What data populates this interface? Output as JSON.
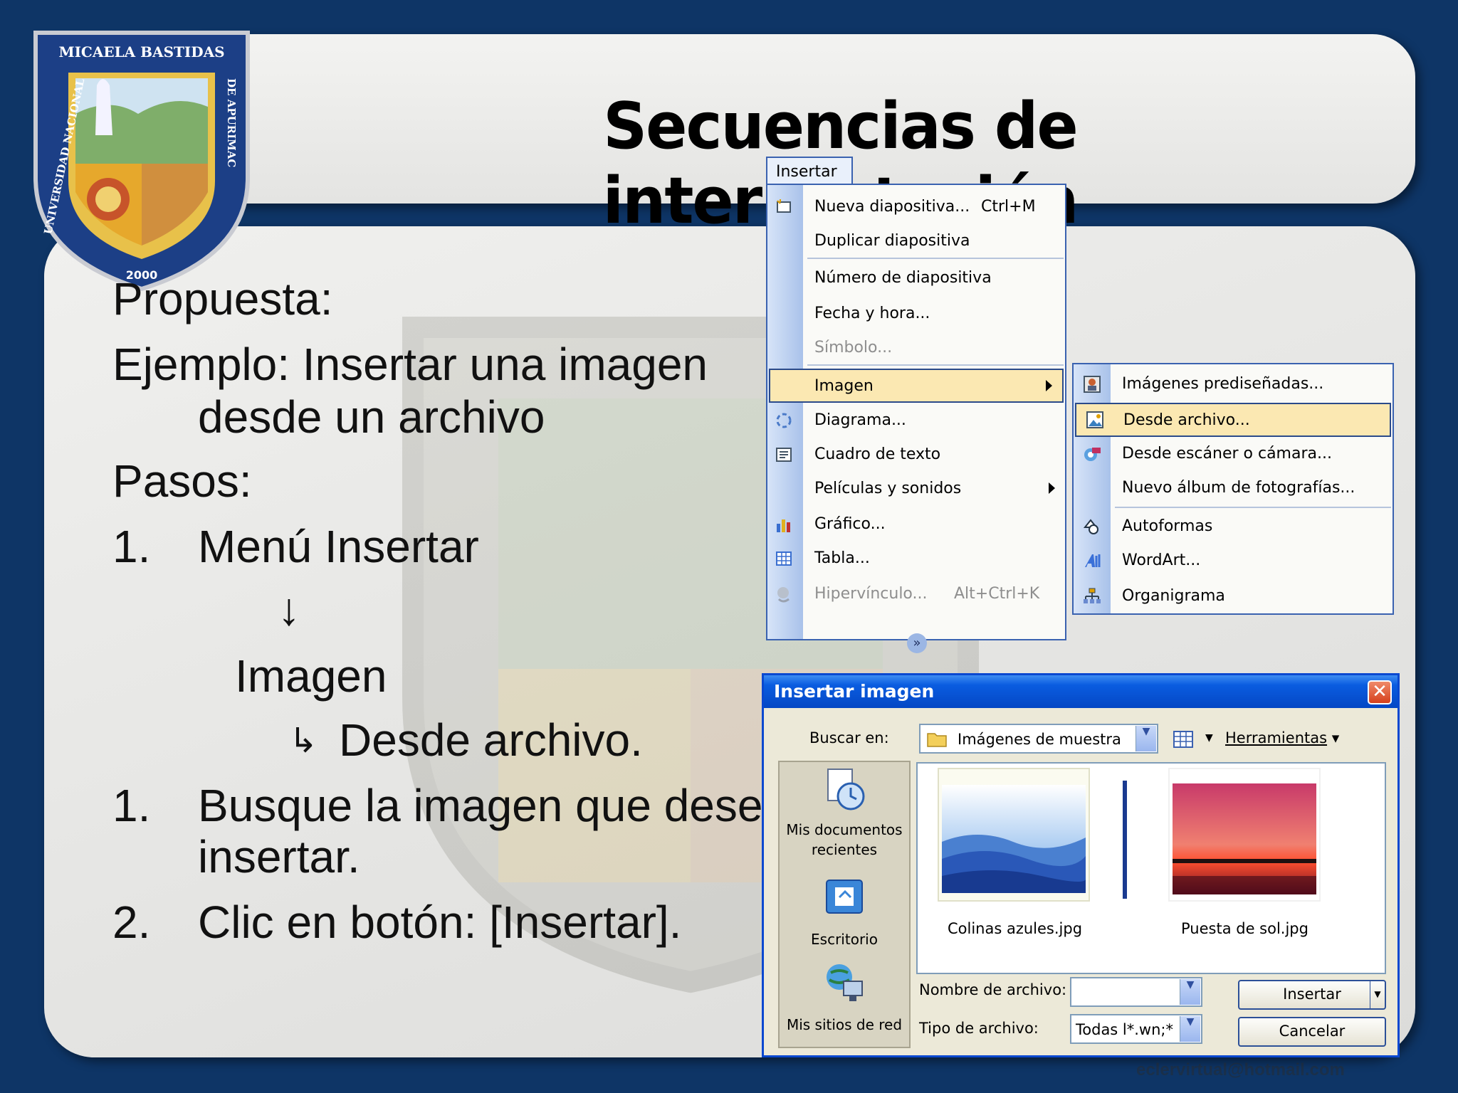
{
  "slide": {
    "title": "Secuencias de interpretación",
    "footer_email": "eclervirtual@hotmail.com"
  },
  "logo": {
    "top_text": "MICAELA BASTIDAS",
    "left_text": "UNIVERSIDAD NACIONAL",
    "right_text": "DE APURIMAC",
    "year": "2000"
  },
  "bullets": {
    "propuesta": "Propuesta:",
    "ejemplo_1": "Ejemplo: Insertar una imagen",
    "ejemplo_2": "desde un archivo",
    "pasos": "Pasos:",
    "step1_num": "1.",
    "step1_text": "Menú Insertar",
    "arrow_down": "↓",
    "imagen": "Imagen",
    "arrow_corner": "↳",
    "desde_archivo": "Desde archivo.",
    "step2_num": "1.",
    "step2_text_1": "Busque la imagen que desee",
    "step2_text_2": "insertar.",
    "step3_num": "2.",
    "step3_text": "Clic en botón:  [Insertar]."
  },
  "menu": {
    "tab_label": "Insertar",
    "items": [
      {
        "label": "Nueva diapositiva...",
        "shortcut": "Ctrl+M"
      },
      {
        "label": "Duplicar diapositiva"
      },
      {
        "label": "Número de diapositiva"
      },
      {
        "label": "Fecha y hora..."
      },
      {
        "label": "Símbolo..."
      },
      {
        "label": "Imagen"
      },
      {
        "label": "Diagrama..."
      },
      {
        "label": "Cuadro de texto"
      },
      {
        "label": "Películas y sonidos"
      },
      {
        "label": "Gráfico..."
      },
      {
        "label": "Tabla..."
      },
      {
        "label": "Hipervínculo...",
        "shortcut": "Alt+Ctrl+K"
      }
    ],
    "expand_icon": "chevron-double-down"
  },
  "submenu": {
    "items": [
      {
        "label": "Imágenes prediseñadas..."
      },
      {
        "label": "Desde archivo..."
      },
      {
        "label": "Desde escáner o cámara..."
      },
      {
        "label": "Nuevo álbum de fotografías..."
      },
      {
        "label": "Autoformas"
      },
      {
        "label": "WordArt..."
      },
      {
        "label": "Organigrama"
      }
    ]
  },
  "dialog": {
    "title": "Insertar imagen",
    "close_glyph": "✕",
    "look_in_label": "Buscar en:",
    "look_in_value": "Imágenes de muestra",
    "tools_label": "Herramientas",
    "places": [
      {
        "label_1": "Mis documentos",
        "label_2": "recientes"
      },
      {
        "label_1": "Escritorio"
      },
      {
        "label_1": "Mis sitios de red"
      }
    ],
    "files": [
      {
        "name": "Colinas azules.jpg"
      },
      {
        "name": "Puesta de sol.jpg"
      }
    ],
    "filename_label": "Nombre de archivo:",
    "filename_value": "",
    "filetype_label": "Tipo de archivo:",
    "filetype_value": "Todas l*.wn;*",
    "insert_button": "Insertar",
    "cancel_button": "Cancelar"
  }
}
